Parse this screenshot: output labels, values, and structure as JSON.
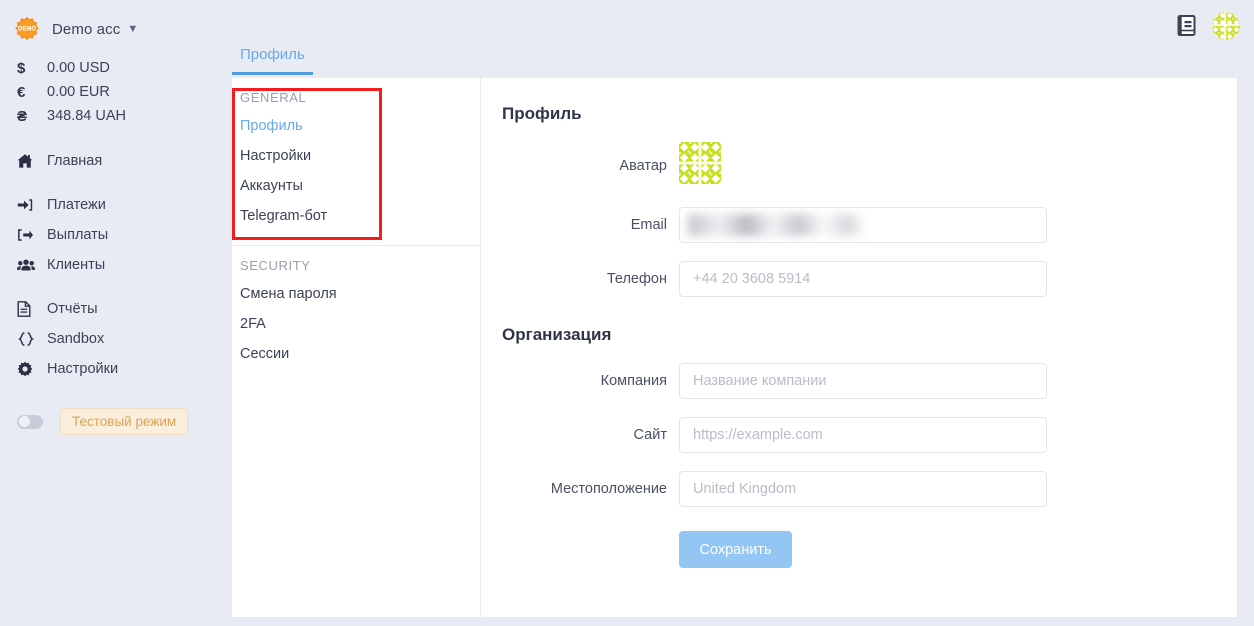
{
  "account": {
    "badge_text": "DEMO",
    "name": "Demo acc",
    "chevron": "chevron-down",
    "balances": [
      {
        "symbol": "$",
        "amount": "0.00 USD"
      },
      {
        "symbol": "€",
        "amount": "0.00 EUR"
      },
      {
        "symbol": "₴",
        "amount": "348.84 UAH"
      }
    ]
  },
  "sidebar": {
    "items": [
      {
        "label": "Главная",
        "icon": "home-icon"
      },
      {
        "label": "Платежи",
        "icon": "sign-in-icon"
      },
      {
        "label": "Выплаты",
        "icon": "sign-out-icon"
      },
      {
        "label": "Клиенты",
        "icon": "users-icon"
      },
      {
        "label": "Отчёты",
        "icon": "document-icon"
      },
      {
        "label": "Sandbox",
        "icon": "code-braces-icon"
      },
      {
        "label": "Настройки",
        "icon": "gear-icon"
      }
    ],
    "test_mode_label": "Тестовый режим",
    "test_mode_on": false
  },
  "tabs": [
    {
      "label": "Профиль",
      "active": true
    }
  ],
  "subnav": {
    "sections": [
      {
        "title": "GENERAL",
        "items": [
          {
            "label": "Профиль",
            "active": true
          },
          {
            "label": "Настройки",
            "active": false
          },
          {
            "label": "Аккаунты",
            "active": false
          },
          {
            "label": "Telegram-бот",
            "active": false
          }
        ]
      },
      {
        "title": "SECURITY",
        "items": [
          {
            "label": "Смена пароля",
            "active": false
          },
          {
            "label": "2FA",
            "active": false
          },
          {
            "label": "Сессии",
            "active": false
          }
        ]
      }
    ]
  },
  "profile": {
    "heading": "Профиль",
    "avatar_label": "Аватар",
    "email_label": "Email",
    "email_value": "",
    "email_redacted": true,
    "phone_label": "Телефон",
    "phone_value": "",
    "phone_placeholder": "+44 20 3608 5914"
  },
  "organization": {
    "heading": "Организация",
    "company_label": "Компания",
    "company_value": "",
    "company_placeholder": "Название компании",
    "site_label": "Сайт",
    "site_value": "",
    "site_placeholder": "https://example.com",
    "location_label": "Местоположение",
    "location_value": "",
    "location_placeholder": "United Kingdom",
    "save_label": "Сохранить"
  },
  "topbar": {
    "docs_icon": "book-icon",
    "avatar_icon": "user-identicon-avatar"
  },
  "annotation": {
    "type": "red-rectangle-highlight",
    "color": "#f41c1c",
    "targets": "GENERAL section of settings sub-navigation"
  },
  "colors": {
    "page_bg": "#e8ebf4",
    "card_bg": "#ffffff",
    "accent_blue": "#4d9de0",
    "link_blue": "#68a9e8",
    "save_button": "#93c5f5",
    "annotation_red": "#f41c1c",
    "avatar_green": "#c6e01e",
    "badge_orange": "#f6911e",
    "test_mode_text": "#e0a34e"
  }
}
